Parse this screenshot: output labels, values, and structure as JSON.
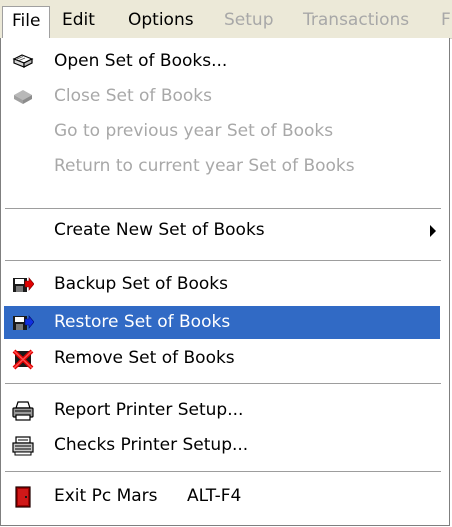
{
  "menubar": {
    "file": "File",
    "edit": "Edit",
    "options": "Options",
    "setup": "Setup",
    "transactions": "Transactions",
    "more": "F"
  },
  "menu": {
    "open": "Open Set of Books...",
    "close": "Close Set of Books",
    "prev_year": "Go to previous year Set of Books",
    "return_current": "Return to current year Set of Books",
    "create_new": "Create New Set of Books",
    "backup": "Backup Set of Books",
    "restore": "Restore Set of Books",
    "remove": "Remove Set of Books",
    "report_printer": "Report Printer Setup...",
    "checks_printer": "Checks Printer Setup...",
    "exit": "Exit Pc Mars",
    "exit_shortcut": "ALT-F4"
  },
  "colors": {
    "selected_bg": "#316ac5",
    "disabled_text": "#a8a8a8",
    "menubar_bg": "#ece9d8"
  },
  "icons": {
    "open": "open-book-icon",
    "close": "closed-book-icon",
    "backup": "disk-backup-icon",
    "restore": "disk-restore-icon",
    "remove": "remove-icon",
    "report_printer": "printer-icon",
    "checks_printer": "check-printer-icon",
    "exit": "exit-door-icon",
    "submenu": "chevron-right-icon"
  }
}
